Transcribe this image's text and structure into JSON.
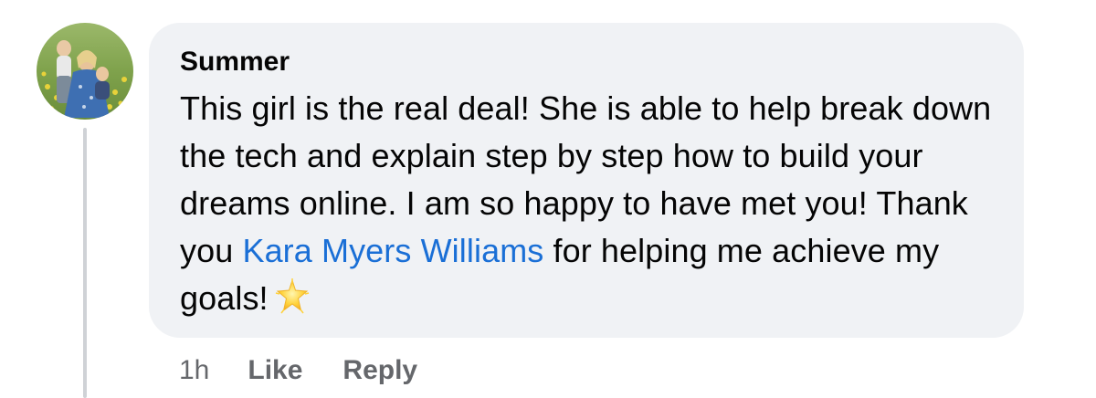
{
  "comment": {
    "author": "Summer",
    "text_before_mention": "This girl is the real deal! She is able to help break down the tech and explain step by step how to build your dreams online. I am so happy to have met you! Thank you ",
    "mention": "Kara Myers Williams",
    "text_after_mention": " for helping me achieve my goals!",
    "emoji_icon": "glowing-star-icon",
    "timestamp": "1h",
    "like_label": "Like",
    "reply_label": "Reply"
  },
  "colors": {
    "bubble_background": "#f0f2f5",
    "mention": "#1a6fd6",
    "secondary_text": "#65676b",
    "thread_line": "#cfd2d6"
  }
}
